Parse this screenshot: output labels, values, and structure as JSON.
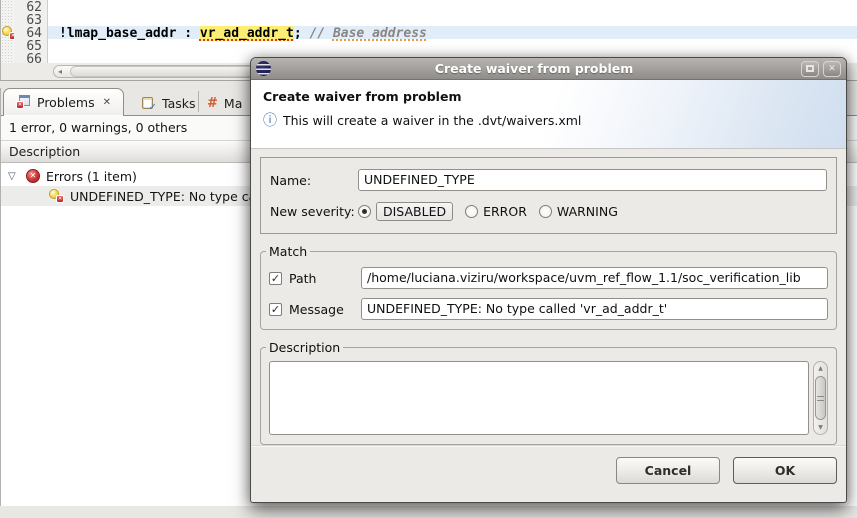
{
  "editor": {
    "lines": [
      {
        "num": "62"
      },
      {
        "num": "63"
      },
      {
        "num": "64"
      },
      {
        "num": "65"
      },
      {
        "num": "66"
      }
    ],
    "active_line": {
      "code_pre": "!lmap_base_addr : ",
      "error_token": "vr_ad_addr_t",
      "code_mid": "; ",
      "comment_prefix": "// ",
      "comment_text": "Base address"
    }
  },
  "panel": {
    "tabs": [
      {
        "label": "Problems"
      },
      {
        "label": "Tasks"
      },
      {
        "label": "Ma"
      }
    ],
    "summary": "1 error, 0 warnings, 0 others",
    "column_header": "Description",
    "tree": [
      {
        "label": "Errors (1 item)"
      },
      {
        "label": "UNDEFINED_TYPE: No type called 'vr_ad_addr_t'"
      }
    ]
  },
  "dialog": {
    "window_title": "Create waiver from problem",
    "header_title": "Create waiver from problem",
    "info_text": "This will create a waiver in the .dvt/waivers.xml",
    "name_label": "Name:",
    "name_value": "UNDEFINED_TYPE",
    "severity_label": "New severity:",
    "severity_options": [
      {
        "label": "DISABLED"
      },
      {
        "label": "ERROR"
      },
      {
        "label": "WARNING"
      }
    ],
    "severity_selected": "DISABLED",
    "match_legend": "Match",
    "path_label": "Path",
    "path_value": "/home/luciana.viziru/workspace/uvm_ref_flow_1.1/soc_verification_lib",
    "message_label": "Message",
    "message_value": "UNDEFINED_TYPE: No type called 'vr_ad_addr_t'",
    "description_legend": "Description",
    "description_value": "",
    "buttons": {
      "cancel": "Cancel",
      "ok": "OK"
    }
  },
  "icons": {
    "close_x": "✕",
    "info": "ⓘ",
    "expander": "▽",
    "hash": "#",
    "check": "✓",
    "error_x": "✕",
    "scroll_left": "◂",
    "scroll_up": "▲",
    "scroll_down": "▼"
  },
  "colors": {
    "error_token_highlight": "#fcee73",
    "current_line": "#e2edfa",
    "error_red": "#cd3535",
    "squiggle_red": "#d4372e",
    "squiggle_orange": "#e79a3c",
    "info_blue": "#3a6aad"
  }
}
